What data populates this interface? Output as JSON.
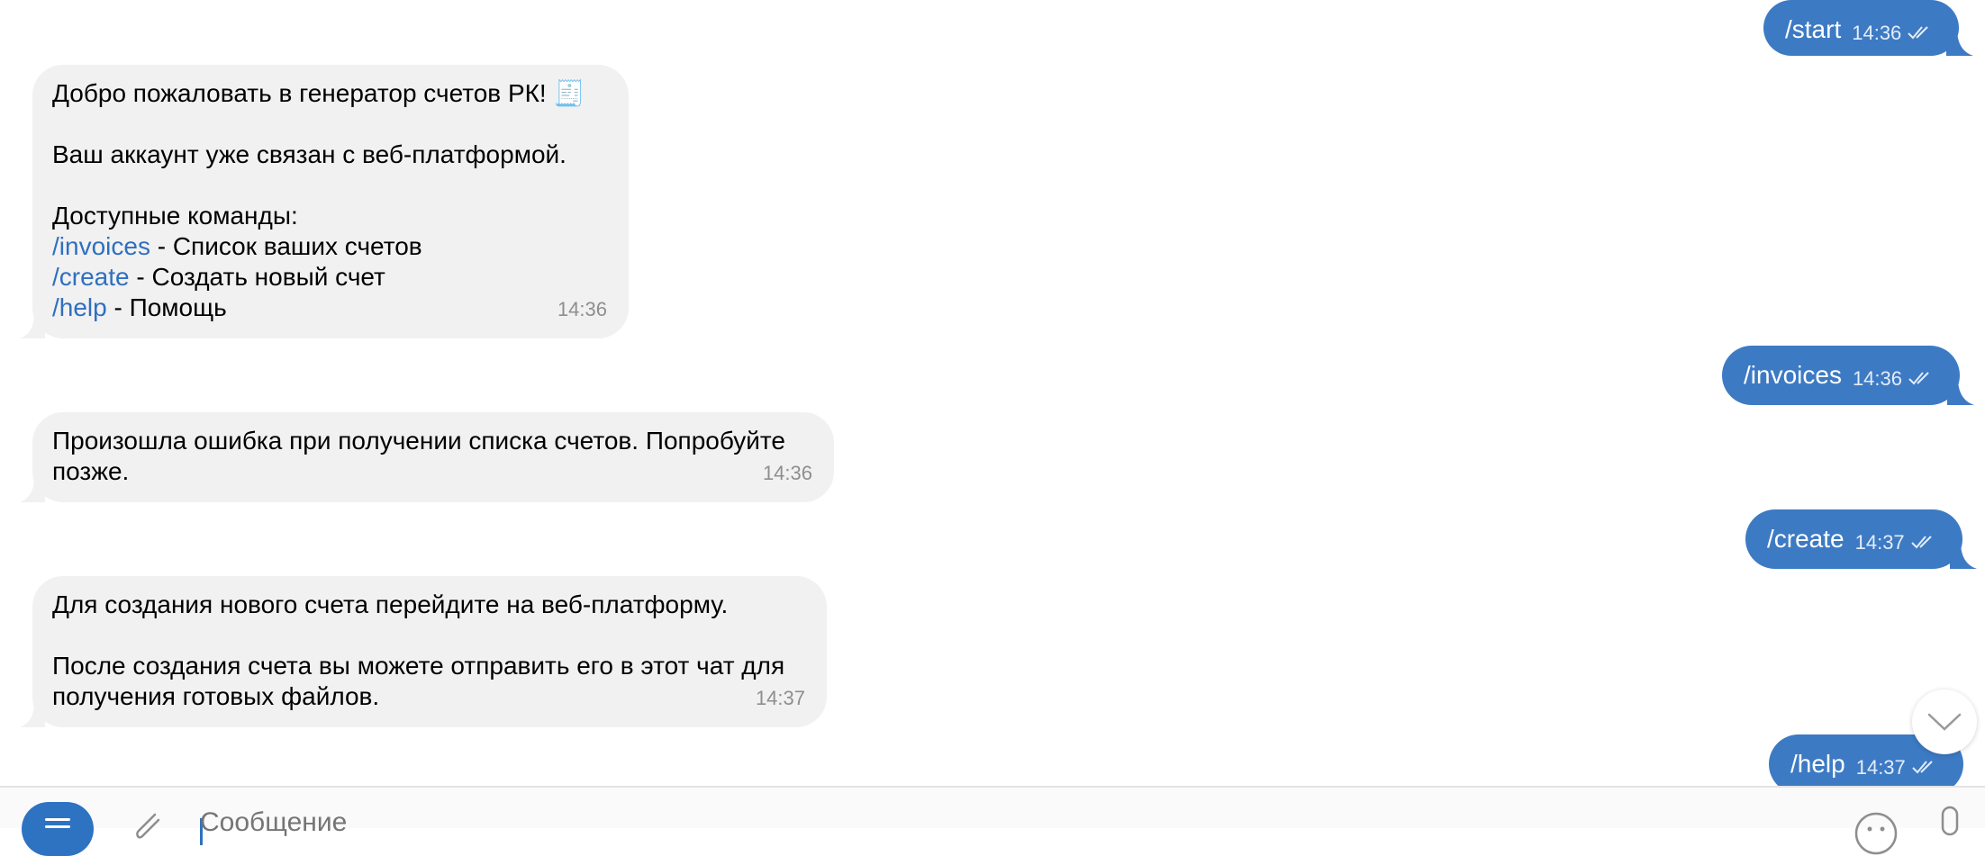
{
  "messages": {
    "start": {
      "text": "/start",
      "time": "14:36"
    },
    "welcome": {
      "title": "Добро пожаловать в генератор счетов РК! 🧾",
      "linked": "Ваш аккаунт уже связан с веб-платформой.",
      "commands_header": "Доступные команды:",
      "cmd1": "/invoices",
      "cmd1_desc": " - Список ваших счетов",
      "cmd2": "/create",
      "cmd2_desc": " - Создать новый счет",
      "cmd3": "/help",
      "cmd3_desc": " - Помощь",
      "time": "14:36"
    },
    "invoices": {
      "text": "/invoices",
      "time": "14:36"
    },
    "error": {
      "line1": "Произошла ошибка при получении списка счетов. Попробуйте",
      "line2": "позже.",
      "time": "14:36"
    },
    "create": {
      "text": "/create",
      "time": "14:37"
    },
    "create_reply": {
      "line1": "Для создания нового счета перейдите на веб-платформу.",
      "line2": "После создания счета вы можете отправить его в этот чат для",
      "line3": "получения готовых файлов.",
      "time": "14:37"
    },
    "help": {
      "text": "/help",
      "time": "14:37"
    }
  },
  "composer": {
    "placeholder": "Сообщение"
  },
  "icons": {
    "read_status": "double-check-icon",
    "scroll_down": "chevron-down-icon",
    "menu": "menu-icon",
    "attach": "paperclip-icon",
    "emoji": "emoji-icon",
    "mic": "microphone-icon"
  },
  "colors": {
    "outgoing_bubble": "#3d7ac4",
    "incoming_bubble": "#f1f1f1",
    "command_link": "#2f6fc0",
    "accent": "#2e72c2"
  }
}
